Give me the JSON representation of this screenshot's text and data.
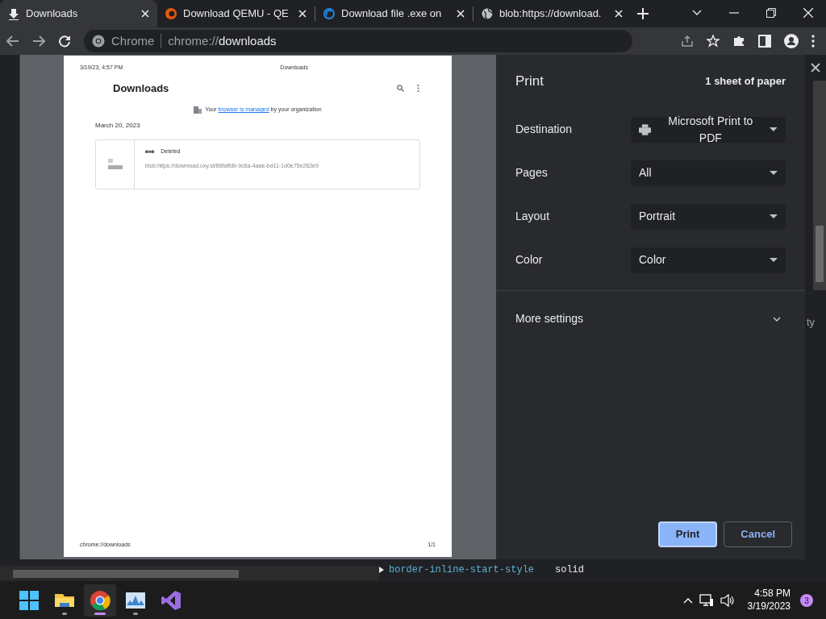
{
  "tabs": [
    {
      "title": "Downloads",
      "kind": "download",
      "selected": true
    },
    {
      "title": "Download QEMU - QE",
      "kind": "qemu",
      "selected": false
    },
    {
      "title": "Download file .exe on",
      "kind": "oxy",
      "selected": false
    },
    {
      "title": "blob:https://download.",
      "kind": "globe",
      "selected": false
    }
  ],
  "address_bar": {
    "site_label": "Chrome",
    "url_scheme": "chrome://",
    "url_host": "downloads"
  },
  "preview": {
    "header_left": "3/19/23, 4:57 PM",
    "header_center": "Downloads",
    "page_title": "Downloads",
    "managed_before": "Your",
    "managed_link": "browser is managed",
    "managed_after": "by your organization",
    "date": "March 20, 2023",
    "item": {
      "file_name": "exe",
      "status": "Deleted",
      "url": "blob:https://download.oxy.st/86faffd9-9c6a-4aae-bd11-1d0e75e282e9"
    },
    "footer_left": "chrome://downloads",
    "footer_right": "1/1"
  },
  "print": {
    "title": "Print",
    "sheets": "1 sheet of paper",
    "settings": [
      {
        "label": "Destination",
        "value": "Microsoft Print to PDF",
        "kind": "printer"
      },
      {
        "label": "Pages",
        "value": "All",
        "kind": "plain"
      },
      {
        "label": "Layout",
        "value": "Portrait",
        "kind": "plain"
      },
      {
        "label": "Color",
        "value": "Color",
        "kind": "plain"
      }
    ],
    "more_settings": "More settings",
    "expanded": false,
    "buttons": [
      {
        "label": "Print",
        "kind": "primary"
      },
      {
        "label": "Cancel",
        "kind": "secondary"
      }
    ]
  },
  "side_text": "ty",
  "devtools": {
    "lines": [
      {
        "property": "border-inline-start-style",
        "value": "solid"
      }
    ]
  },
  "taskbar": {
    "apps": [
      {
        "kind": "explorer",
        "running": true,
        "selected": false
      },
      {
        "kind": "chrome",
        "running": true,
        "selected": true
      },
      {
        "kind": "monitor",
        "running": true,
        "selected": false
      },
      {
        "kind": "studio",
        "running": false,
        "selected": false
      }
    ],
    "time": "4:58 PM",
    "date": "3/19/2023",
    "notification_count": "3"
  }
}
